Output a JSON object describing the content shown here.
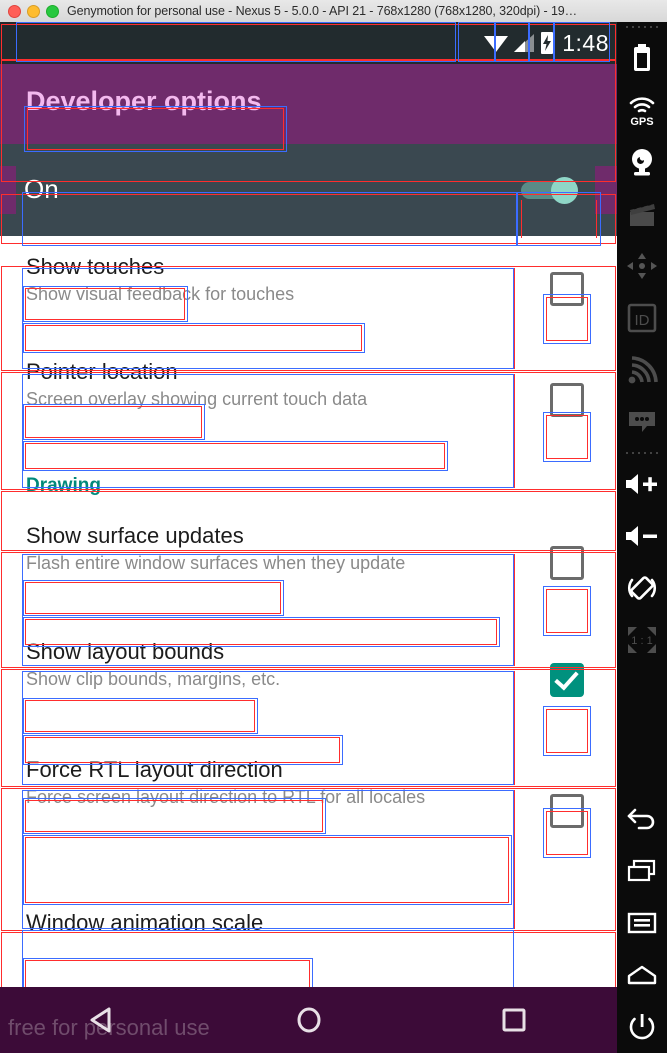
{
  "window": {
    "title": "Genymotion for personal use - Nexus 5 - 5.0.0 - API 21 - 768x1280 (768x1280, 320dpi) - 19…",
    "traffic_lights": [
      "close",
      "minimize",
      "maximize"
    ]
  },
  "statusbar": {
    "clock": "1:48",
    "icons": [
      "wifi-icon",
      "cellular-signal-icon",
      "battery-charging-icon"
    ]
  },
  "actionbar": {
    "title": "Developer options",
    "background": "#6f2b6b",
    "title_color": "#f3b9ee"
  },
  "master_switch": {
    "label": "On",
    "state": "on",
    "track_color": "#5a8b87",
    "thumb_color": "#8fd6c7"
  },
  "list": [
    {
      "type": "item",
      "title": "Show touches",
      "subtitle": "Show visual feedback for touches",
      "checked": false
    },
    {
      "type": "item",
      "title": "Pointer location",
      "subtitle": "Screen overlay showing current touch data",
      "checked": false
    },
    {
      "type": "section",
      "title": "Drawing",
      "color": "#00897b"
    },
    {
      "type": "item",
      "title": "Show surface updates",
      "subtitle": "Flash entire window surfaces when they update",
      "checked": false
    },
    {
      "type": "item",
      "title": "Show layout bounds",
      "subtitle": "Show clip bounds, margins, etc.",
      "checked": true
    },
    {
      "type": "item",
      "title": "Force RTL layout direction",
      "subtitle": "Force screen layout direction to RTL for all locales",
      "checked": false
    },
    {
      "type": "item",
      "title": "Window animation scale",
      "subtitle": "",
      "checked": null
    }
  ],
  "navbar": {
    "background": "#3c0b38",
    "buttons": [
      "back-triangle-icon",
      "home-circle-icon",
      "recents-square-icon"
    ],
    "watermark": "free for personal use"
  },
  "toolbar": {
    "items": [
      {
        "name": "battery-icon",
        "label": ""
      },
      {
        "name": "gps-icon",
        "label": "GPS"
      },
      {
        "name": "camera-icon",
        "label": ""
      },
      {
        "name": "video-clapper-icon",
        "label": ""
      },
      {
        "name": "dpad-icon",
        "label": ""
      },
      {
        "name": "id-icon",
        "label": "ID"
      },
      {
        "name": "network-signal-icon",
        "label": ""
      },
      {
        "name": "sms-bubble-icon",
        "label": ""
      },
      {
        "name": "volume-up-icon",
        "label": ""
      },
      {
        "name": "volume-down-icon",
        "label": ""
      },
      {
        "name": "rotate-screen-icon",
        "label": ""
      },
      {
        "name": "scale-one-to-one-icon",
        "label": "1 : 1"
      },
      {
        "name": "back-arrow-icon",
        "label": ""
      },
      {
        "name": "recents-icon",
        "label": ""
      },
      {
        "name": "menu-icon",
        "label": ""
      },
      {
        "name": "home-icon",
        "label": ""
      },
      {
        "name": "power-icon",
        "label": ""
      }
    ]
  },
  "debug_overlay": {
    "enabled": true,
    "bounds_color": "#ff2d2d",
    "margins_color": "#3b6cff"
  }
}
